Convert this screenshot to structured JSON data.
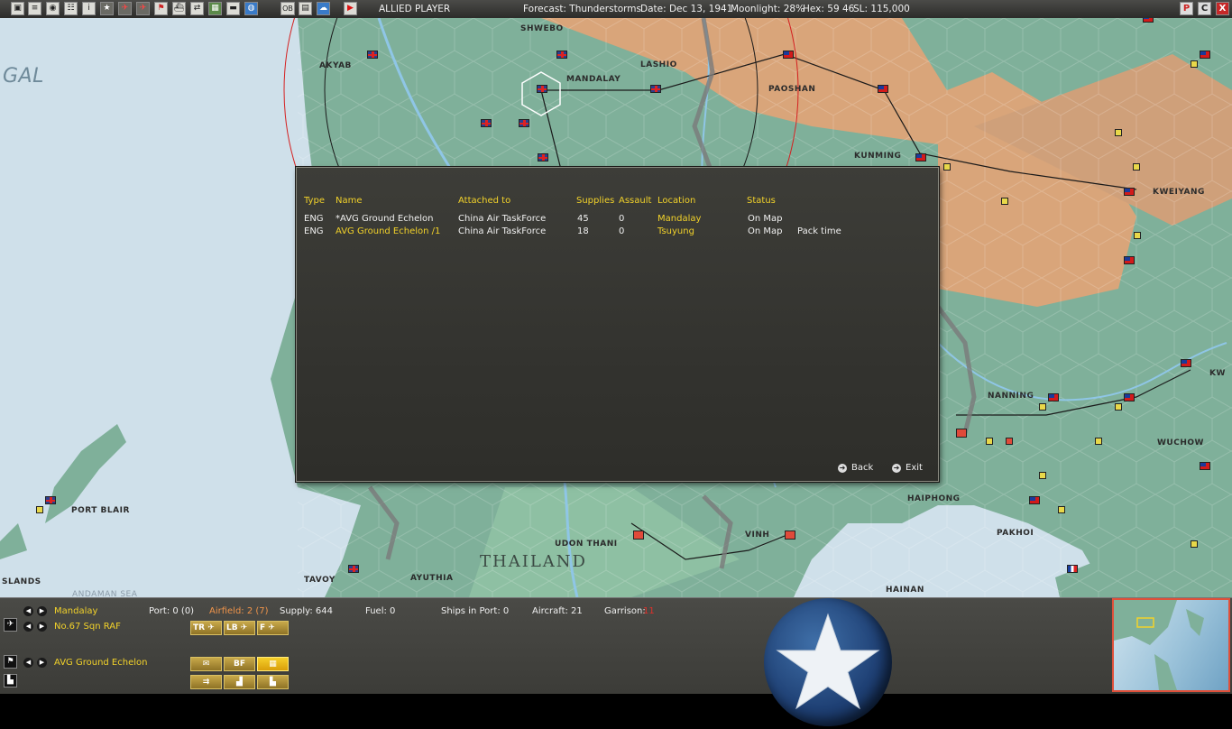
{
  "toolbar": {
    "buttons": [
      "save-icon",
      "doc-icon",
      "report-icon",
      "list-icon",
      "info-icon",
      "star-icon",
      "fighter-icon",
      "bomber-icon",
      "flag-icon",
      "ship-icon",
      "transfer-icon",
      "map-icon",
      "base-icon",
      "globe-icon",
      "ob-icon",
      "table-icon",
      "cloud-icon",
      "end-turn-icon"
    ],
    "ob_label": "OB",
    "info_label": "i",
    "player": "ALLIED PLAYER",
    "forecast": "Forecast: Thunderstorms",
    "date": "Date: Dec 13, 1941",
    "moonlight": "Moonlight: 28%",
    "hex": "Hex: 59  46",
    "sl": "SL: 115,000",
    "win_buttons": [
      "P",
      "C",
      "X"
    ]
  },
  "map": {
    "labels": {
      "gal": "GAL",
      "akyab": "AKYAB",
      "shwebo": "SHWEBO",
      "mandalay": "MANDALAY",
      "lashio": "LASHIO",
      "paoshan": "PAOSHAN",
      "kunming": "KUNMING",
      "kweiyang": "KWEIYANG",
      "nanning": "NANNING",
      "wuchow": "WUCHOW",
      "haiphong": "HAIPHONG",
      "pakhoi": "PAKHOI",
      "hainan": "HAINAN",
      "vinh": "VINH",
      "udon_thani": "UDON THANI",
      "thailand": "THAILAND",
      "tavoy": "TAVOY",
      "ayuthia": "AYUTHIA",
      "port_blair": "PORT BLAIR",
      "slands": "SLANDS",
      "andaman_sea": "ANDAMAN SEA",
      "kw": "KW"
    }
  },
  "dialog": {
    "headers": {
      "type": "Type",
      "name": "Name",
      "attached": "Attached to",
      "supplies": "Supplies",
      "assault": "Assault",
      "location": "Location",
      "status": "Status"
    },
    "rows": [
      {
        "type": "ENG",
        "name": "*AVG Ground Echelon",
        "attached": "China Air TaskForce",
        "supplies": "45",
        "assault": "0",
        "location": "Mandalay",
        "status": "On Map",
        "extra": ""
      },
      {
        "type": "ENG",
        "name": "AVG Ground Echelon /1",
        "attached": "China Air TaskForce",
        "supplies": "18",
        "assault": "0",
        "location": "Tsuyung",
        "status": "On Map",
        "extra": "Pack time"
      }
    ],
    "back_label": "Back",
    "exit_label": "Exit"
  },
  "bottom": {
    "base_name": "Mandalay",
    "port": "Port: 0 (0)",
    "airfield": "Airfield: 2 (7)",
    "supply": "Supply: 644",
    "fuel": "Fuel: 0",
    "ships_in_port": "Ships in Port: 0",
    "aircraft": "Aircraft: 21",
    "garrison_label": "Garrison:",
    "garrison_value": "11",
    "air_unit": "No.67 Sqn RAF",
    "ground_unit": "AVG Ground Echelon",
    "air_buttons": [
      "TR",
      "LB",
      "F"
    ],
    "ground_buttons": [
      "mail-icon",
      "BF",
      "board-icon",
      "transfer-icon",
      "city-icon",
      "factory-icon"
    ],
    "bf_label": "BF"
  },
  "colors": {
    "accent_yellow": "#f2d22a",
    "dialog_bg": "#36362f",
    "airfield_orange": "#f0944a",
    "garrison_red": "#e0302a"
  }
}
